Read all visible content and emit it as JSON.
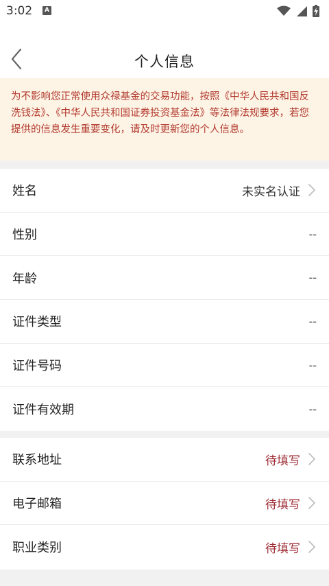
{
  "status_bar": {
    "time": "3:02",
    "notification_icon": "A",
    "icons": [
      "wifi-icon",
      "signal-icon",
      "battery-icon"
    ]
  },
  "header": {
    "title": "个人信息",
    "back_icon": "chevron-left-icon"
  },
  "notice": {
    "text": "为不影响您正常使用众禄基金的交易功能，按照《中华人民共和国反洗钱法》、《中华人民共和国证券投资基金法》等法律法规要求，若您提供的信息发生重要变化，请及时更新您的个人信息。"
  },
  "identity_section": {
    "rows": [
      {
        "label": "姓名",
        "value": "未实名认证",
        "has_arrow": true
      },
      {
        "label": "性别",
        "value": "--",
        "has_arrow": false
      },
      {
        "label": "年龄",
        "value": "--",
        "has_arrow": false
      },
      {
        "label": "证件类型",
        "value": "--",
        "has_arrow": false
      },
      {
        "label": "证件号码",
        "value": "--",
        "has_arrow": false
      },
      {
        "label": "证件有效期",
        "value": "--",
        "has_arrow": false
      }
    ]
  },
  "contact_section": {
    "rows": [
      {
        "label": "联系地址",
        "value": "待填写",
        "has_arrow": true
      },
      {
        "label": "电子邮箱",
        "value": "待填写",
        "has_arrow": true
      },
      {
        "label": "职业类别",
        "value": "待填写",
        "has_arrow": true
      }
    ]
  },
  "colors": {
    "notice_bg": "#fdf4e6",
    "notice_text": "#b23a2e",
    "pending_text": "#9e2b33",
    "page_bg": "#f1f1f1"
  }
}
